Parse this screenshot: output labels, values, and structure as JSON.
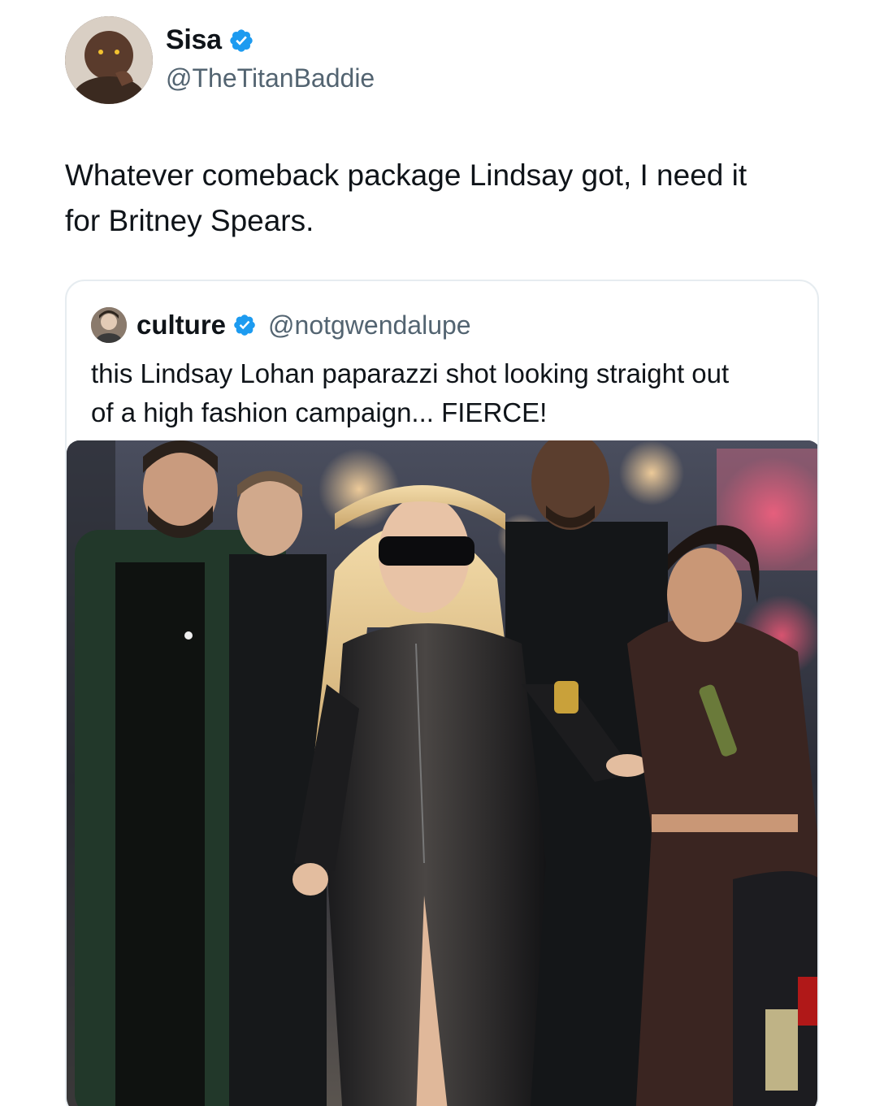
{
  "tweet": {
    "author": {
      "display_name": "Sisa",
      "handle": "@TheTitanBaddie",
      "verified": true
    },
    "text_line1": "Whatever comeback package Lindsay got, I need it",
    "text_line2": "for Britney Spears."
  },
  "quoted_tweet": {
    "author": {
      "display_name": "culture",
      "handle": "@notgwendalupe",
      "verified": true
    },
    "text_line1": "this Lindsay Lohan paparazzi shot looking straight out",
    "text_line2": "of a high fashion campaign... FIERCE!",
    "media": {
      "type": "photo"
    }
  },
  "colors": {
    "text_primary": "#0f1419",
    "text_secondary": "#536471",
    "verified_blue": "#1d9bf0",
    "border": "#e6ecf0"
  }
}
